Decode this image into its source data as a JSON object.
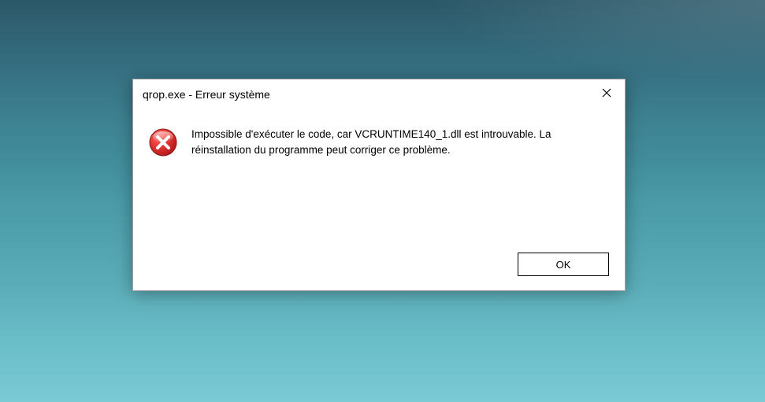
{
  "dialog": {
    "title": "qrop.exe - Erreur système",
    "message": "Impossible d'exécuter le code, car VCRUNTIME140_1.dll est introuvable. La réinstallation du programme peut corriger ce problème.",
    "ok_label": "OK"
  }
}
